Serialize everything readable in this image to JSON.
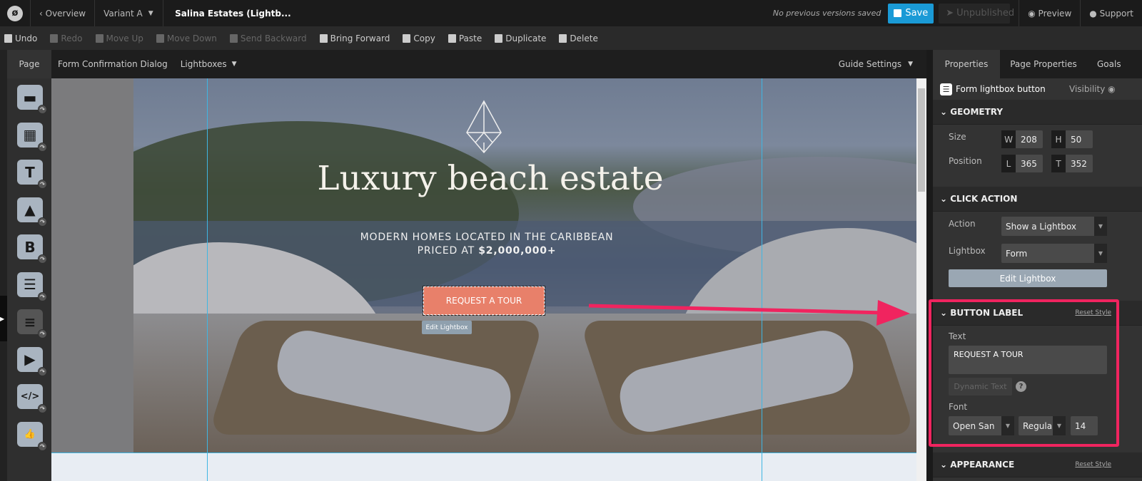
{
  "topbar": {
    "overview": "Overview",
    "variant": "Variant A",
    "page_name": "Salina Estates (Lightb...",
    "versions": "No previous versions saved",
    "save": "Save",
    "unpublished": "Unpublished",
    "preview": "Preview",
    "support": "Support"
  },
  "toolbar": [
    {
      "label": "Undo",
      "enabled": true
    },
    {
      "label": "Redo",
      "enabled": false
    },
    {
      "label": "Move Up",
      "enabled": false
    },
    {
      "label": "Move Down",
      "enabled": false
    },
    {
      "label": "Send Backward",
      "enabled": false
    },
    {
      "label": "Bring Forward",
      "enabled": true
    },
    {
      "label": "Copy",
      "enabled": true
    },
    {
      "label": "Paste",
      "enabled": true
    },
    {
      "label": "Duplicate",
      "enabled": true
    },
    {
      "label": "Delete",
      "enabled": true
    }
  ],
  "page_tabs": {
    "page": "Page",
    "form_confirmation": "Form Confirmation Dialog",
    "lightboxes": "Lightboxes",
    "guide_settings": "Guide Settings"
  },
  "widgets": [
    {
      "name": "section-icon",
      "glyph": "▬"
    },
    {
      "name": "box-icon",
      "glyph": "▦"
    },
    {
      "name": "text-icon",
      "glyph": "T"
    },
    {
      "name": "image-icon",
      "glyph": "▲"
    },
    {
      "name": "button-icon",
      "glyph": "B"
    },
    {
      "name": "form-icon",
      "glyph": "☰"
    },
    {
      "name": "form-fields-icon",
      "glyph": "≡"
    },
    {
      "name": "video-icon",
      "glyph": "▶"
    },
    {
      "name": "code-icon",
      "glyph": "</>"
    },
    {
      "name": "social-icon",
      "glyph": "👍"
    }
  ],
  "hero": {
    "title": "Luxury beach estate",
    "subtitle_line1": "MODERN HOMES LOCATED IN THE CARIBBEAN",
    "subtitle_line2_prefix": "PRICED AT ",
    "subtitle_price": "$2,000,000+",
    "button": "REQUEST A TOUR",
    "edit_lightbox_tag": "Edit Lightbox",
    "button_color": "#e8806a"
  },
  "panel": {
    "tabs": [
      "Properties",
      "Page Properties",
      "Goals"
    ],
    "element_name": "Form lightbox button",
    "visibility": "Visibility",
    "geometry": {
      "title": "GEOMETRY",
      "size_label": "Size",
      "position_label": "Position",
      "w_key": "W",
      "w": "208",
      "h_key": "H",
      "h": "50",
      "l_key": "L",
      "l": "365",
      "t_key": "T",
      "t": "352"
    },
    "click_action": {
      "title": "CLICK ACTION",
      "action_label": "Action",
      "action": "Show a Lightbox",
      "lightbox_label": "Lightbox",
      "lightbox": "Form",
      "edit_button": "Edit Lightbox"
    },
    "button_label": {
      "title": "BUTTON LABEL",
      "reset": "Reset Style",
      "text_label": "Text",
      "text": "REQUEST A TOUR",
      "dynamic_text": "Dynamic Text",
      "help": "?",
      "font_label": "Font",
      "font": "Open San",
      "weight": "Regular",
      "size": "14"
    },
    "appearance": {
      "title": "APPEARANCE",
      "reset": "Reset Style"
    }
  },
  "colors": {
    "accent": "#1a9ad6",
    "highlight": "#f0245f",
    "guide": "#3fb6e3"
  }
}
